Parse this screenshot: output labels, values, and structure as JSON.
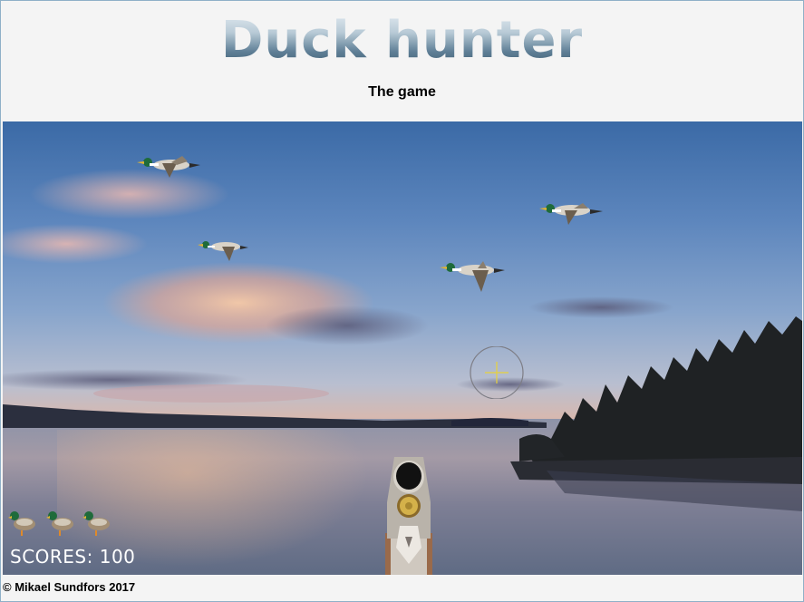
{
  "header": {
    "title": "Duck hunter",
    "subtitle": "The game"
  },
  "game": {
    "score_text": "SCORES: 100",
    "score": 100,
    "lives": 3,
    "ducks_in_flight": 4
  },
  "footer": {
    "copyright": "© Mikael Sundfors 2017"
  },
  "icons": {
    "duck": "mallard-duck-icon",
    "life": "life-duck-icon",
    "crosshair": "crosshair-icon",
    "shotgun": "shotgun-icon"
  },
  "colors": {
    "title_gradient_top": "#dfe8ef",
    "title_gradient_bottom": "#3d5a70",
    "background": "#f4f4f4",
    "crosshair_color": "#e8d23a"
  }
}
